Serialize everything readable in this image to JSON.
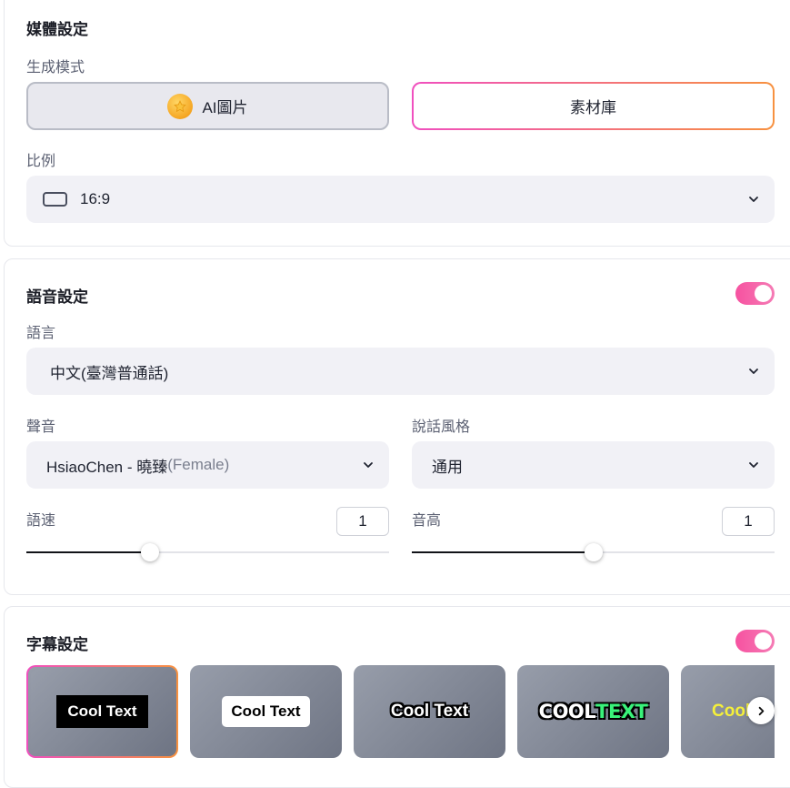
{
  "media": {
    "title": "媒體設定",
    "mode_label": "生成模式",
    "mode_ai": "AI圖片",
    "mode_library": "素材庫",
    "ratio_label": "比例",
    "ratio_value": "16:9"
  },
  "voice": {
    "title": "語音設定",
    "enabled": true,
    "language_label": "語言",
    "language_value": "中文(臺灣普通話)",
    "voice_label": "聲音",
    "voice_name": "HsiaoChen - 曉臻",
    "voice_gender": "(Female)",
    "style_label": "說話風格",
    "style_value": "通用",
    "speed_label": "語速",
    "speed_value": "1",
    "speed_fraction": 0.34,
    "pitch_label": "音高",
    "pitch_value": "1",
    "pitch_fraction": 0.5
  },
  "subtitle": {
    "title": "字幕設定",
    "enabled": true,
    "styles": [
      {
        "text": "Cool Text",
        "selected": true
      },
      {
        "text": "Cool Text"
      },
      {
        "text": "Cool Text"
      },
      {
        "text_a": "COOL",
        "text_b": "TEXT"
      },
      {
        "text": "Cool"
      }
    ]
  },
  "colors": {
    "accent_pink": "#f04fbf",
    "accent_orange": "#f7913f",
    "toggle": "#f652a0"
  }
}
